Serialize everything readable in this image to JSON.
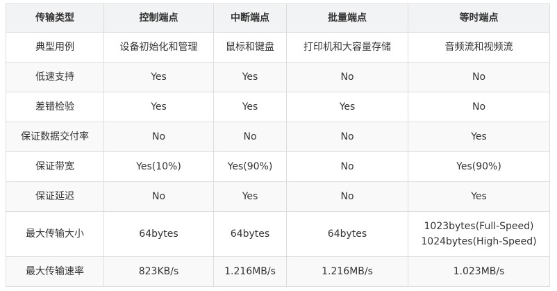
{
  "table": {
    "headers": [
      "传输类型",
      "控制端点",
      "中断端点",
      "批量端点",
      "等时端点"
    ],
    "rows": [
      [
        "典型用例",
        "设备初始化和管理",
        "鼠标和键盘",
        "打印机和大容量存储",
        "音频流和视频流"
      ],
      [
        "低速支持",
        "Yes",
        "Yes",
        "No",
        "No"
      ],
      [
        "差错检验",
        "Yes",
        "Yes",
        "Yes",
        "No"
      ],
      [
        "保证数据交付率",
        "No",
        "No",
        "No",
        "Yes"
      ],
      [
        "保证带宽",
        "Yes(10%)",
        "Yes(90%)",
        "No",
        "Yes(90%)"
      ],
      [
        "保证延迟",
        "No",
        "Yes",
        "No",
        "Yes"
      ],
      [
        "最大传输大小",
        "64bytes",
        "64bytes",
        "64bytes",
        [
          "1023bytes(Full-Speed)",
          "1024bytes(High-Speed)"
        ]
      ],
      [
        "最大传输速率",
        "823KB/s",
        "1.216MB/s",
        "1.216MB/s",
        "1.023MB/s"
      ]
    ]
  }
}
